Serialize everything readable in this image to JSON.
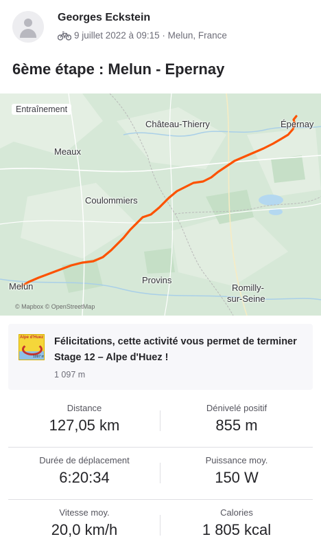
{
  "activity": {
    "author": "Georges Eckstein",
    "date_location": "9 juillet 2022 à 09:15 · Melun, France",
    "sport_icon": "bike-icon",
    "title": "6ème étape : Melun - Epernay"
  },
  "map": {
    "badge": "Entraînement",
    "attribution": "© Mapbox © OpenStreetMap",
    "route_color": "#fc5200",
    "cities": {
      "chateau": "Château-Thierry",
      "epernay": "Épernay",
      "meaux": "Meaux",
      "coulommiers": "Coulommiers",
      "melun": "Melun",
      "provins": "Provins",
      "romilly_1": "Romilly-",
      "romilly_2": "sur-Seine"
    }
  },
  "achievement": {
    "text": "Félicitations, cette activité vous permet de terminer Stage 12 – Alpe d'Huez !",
    "subtext": "1 097 m",
    "badge_label": "Alpe d'Huez",
    "badge_sub": "1097 m"
  },
  "stats": [
    {
      "label": "Distance",
      "value": "127,05 km"
    },
    {
      "label": "Dénivelé positif",
      "value": "855 m"
    },
    {
      "label": "Durée de déplacement",
      "value": "6:20:34"
    },
    {
      "label": "Puissance moy.",
      "value": "150 W"
    },
    {
      "label": "Vitesse moy.",
      "value": "20,0 km/h"
    },
    {
      "label": "Calories",
      "value": "1 805 kcal"
    }
  ]
}
